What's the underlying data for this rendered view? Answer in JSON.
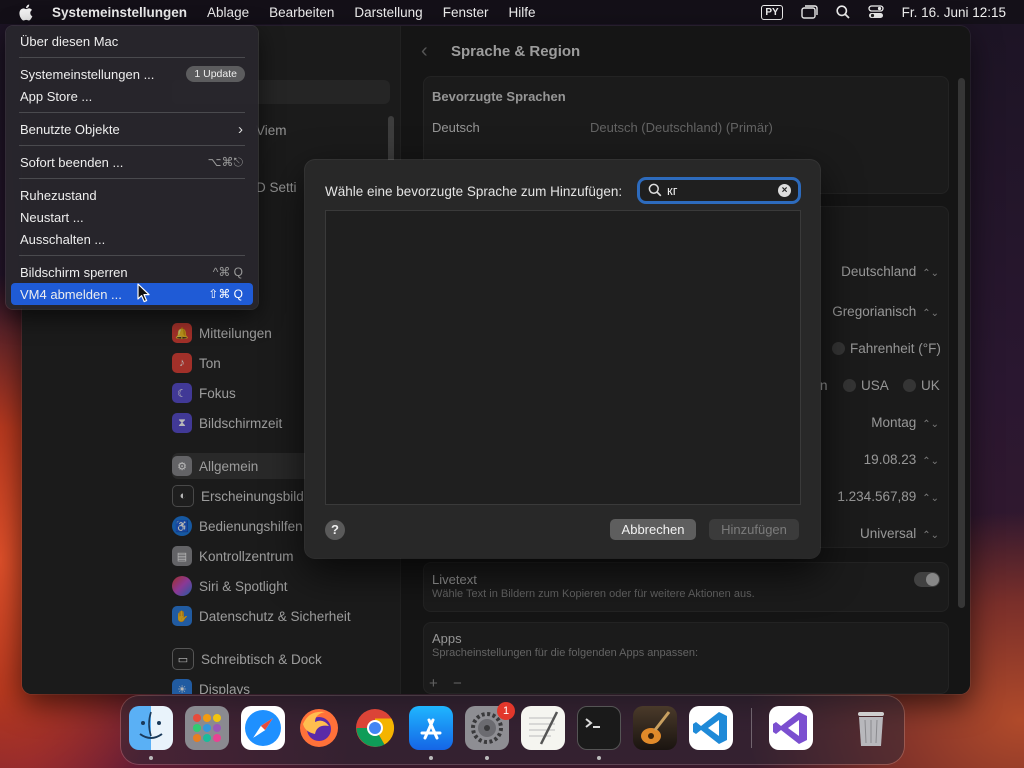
{
  "menubar": {
    "app": "Systemeinstellungen",
    "items": [
      "Ablage",
      "Bearbeiten",
      "Darstellung",
      "Fenster",
      "Hilfe"
    ],
    "input_source": "PY",
    "clock": "Fr. 16. Juni  12:15"
  },
  "apple_menu": {
    "about": "Über diesen Mac",
    "settings": "Systemeinstellungen ...",
    "settings_badge": "1 Update",
    "app_store": "App Store ...",
    "recent": "Benutzte Objekte",
    "recent_arrow": "›",
    "force_quit": "Sofort beenden ...",
    "force_quit_key": "⌥⌘⎋",
    "sleep": "Ruhezustand",
    "restart": "Neustart ...",
    "shutdown": "Ausschalten ...",
    "lock": "Bildschirm sperren",
    "lock_key": "^⌘ Q",
    "logout": "VM4 abmelden ...",
    "logout_key": "⇧⌘ Q"
  },
  "sidebar": {
    "partial_1": "Viem",
    "partial_2": "D Setti",
    "items": [
      {
        "label": "Mitteilungen",
        "color": "#e0433a"
      },
      {
        "label": "Ton",
        "color": "#e0433a"
      },
      {
        "label": "Fokus",
        "color": "#5a4fd0"
      },
      {
        "label": "Bildschirmzeit",
        "color": "#5a4fd0"
      },
      {
        "label": "Allgemein",
        "color": "#8a8a8e"
      },
      {
        "label": "Erscheinungsbild",
        "color": "#2a2a2a"
      },
      {
        "label": "Bedienungshilfen",
        "color": "#1f7ae0"
      },
      {
        "label": "Kontrollzentrum",
        "color": "#8a8a8e"
      },
      {
        "label": "Siri & Spotlight",
        "color": "#c04fd0"
      },
      {
        "label": "Datenschutz & Sicherheit",
        "color": "#2f7fe0"
      },
      {
        "label": "Schreibtisch & Dock",
        "color": "#2a2a2a"
      },
      {
        "label": "Displays",
        "color": "#2f7fe0"
      }
    ]
  },
  "content": {
    "title": "Sprache & Region",
    "preferred_heading": "Bevorzugte Sprachen",
    "lang_name": "Deutsch",
    "lang_detail": "Deutsch (Deutschland) (Primär)",
    "region": "Deutschland",
    "calendar": "Gregorianisch",
    "temp_option": "Fahrenheit (°F)",
    "measure_usa": "USA",
    "measure_uk": "UK",
    "measure_prefix": "n",
    "first_day": "Montag",
    "date_format": "19.08.23",
    "number_format": "1.234.567,89",
    "sort_order": "Universal",
    "livetext_title": "Livetext",
    "livetext_desc": "Wähle Text in Bildern zum Kopieren oder für weitere Aktionen aus.",
    "apps_title": "Apps",
    "apps_desc": "Spracheinstellungen für die folgenden Apps anpassen:",
    "plus": "+",
    "minus": "−"
  },
  "sheet": {
    "prompt": "Wähle eine bevorzugte Sprache zum Hinzufügen:",
    "search_value": "кг",
    "help": "?",
    "cancel": "Abbrechen",
    "add": "Hinzufügen"
  },
  "dock": {
    "settings_badge": "1"
  }
}
